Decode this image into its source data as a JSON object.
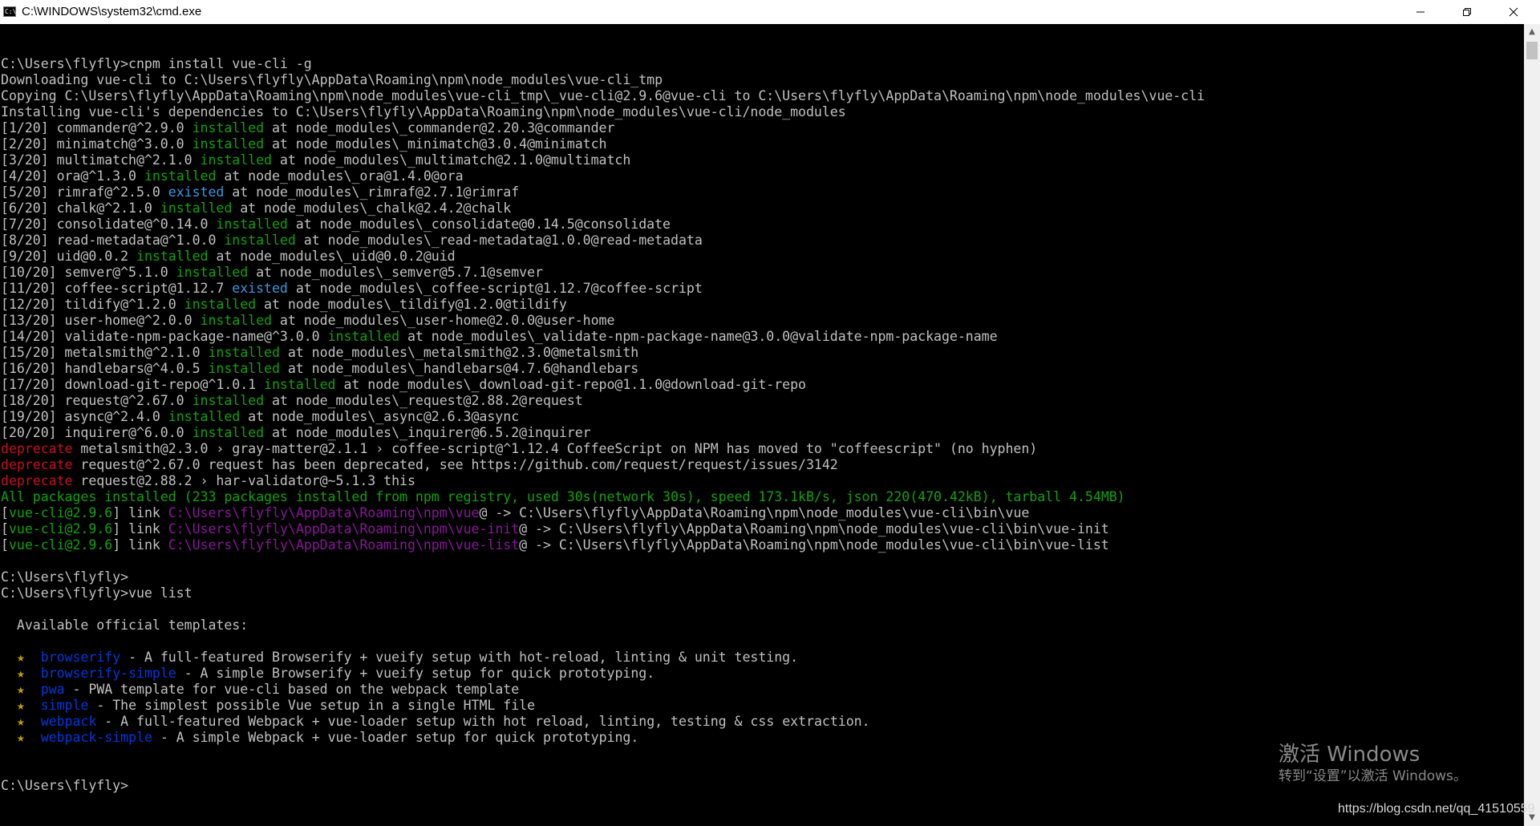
{
  "window": {
    "title": "C:\\WINDOWS\\system32\\cmd.exe",
    "app_icon_text": "C:\\",
    "icons": {
      "app": "console-icon",
      "minimize": "minimize-icon",
      "maximize": "restore-icon",
      "close": "close-icon"
    }
  },
  "console": {
    "colors": {
      "default": "#c0c0c0",
      "green": "#13a10e",
      "teal": "#3a96dd",
      "red": "#c50f1f",
      "magenta": "#881798",
      "blue": "#0037da",
      "yellow": "#c19c00"
    },
    "lines": [
      [
        {
          "t": "C:\\Users\\flyfly>cnpm install vue-cli -g"
        }
      ],
      [
        {
          "t": "Downloading vue-cli to C:\\Users\\flyfly\\AppData\\Roaming\\npm\\node_modules\\vue-cli_tmp"
        }
      ],
      [
        {
          "t": "Copying C:\\Users\\flyfly\\AppData\\Roaming\\npm\\node_modules\\vue-cli_tmp\\_vue-cli@2.9.6@vue-cli to C:\\Users\\flyfly\\AppData\\Roaming\\npm\\node_modules\\vue-cli"
        }
      ],
      [
        {
          "t": "Installing vue-cli's dependencies to C:\\Users\\flyfly\\AppData\\Roaming\\npm\\node_modules\\vue-cli/node_modules"
        }
      ],
      [
        {
          "t": "[1/20] commander@^2.9.0 "
        },
        {
          "t": "installed",
          "c": "g"
        },
        {
          "t": " at node_modules\\_commander@2.20.3@commander"
        }
      ],
      [
        {
          "t": "[2/20] minimatch@^3.0.0 "
        },
        {
          "t": "installed",
          "c": "g"
        },
        {
          "t": " at node_modules\\_minimatch@3.0.4@minimatch"
        }
      ],
      [
        {
          "t": "[3/20] multimatch@^2.1.0 "
        },
        {
          "t": "installed",
          "c": "g"
        },
        {
          "t": " at node_modules\\_multimatch@2.1.0@multimatch"
        }
      ],
      [
        {
          "t": "[4/20] ora@^1.3.0 "
        },
        {
          "t": "installed",
          "c": "g"
        },
        {
          "t": " at node_modules\\_ora@1.4.0@ora"
        }
      ],
      [
        {
          "t": "[5/20] rimraf@^2.5.0 "
        },
        {
          "t": "existed",
          "c": "t"
        },
        {
          "t": " at node_modules\\_rimraf@2.7.1@rimraf"
        }
      ],
      [
        {
          "t": "[6/20] chalk@^2.1.0 "
        },
        {
          "t": "installed",
          "c": "g"
        },
        {
          "t": " at node_modules\\_chalk@2.4.2@chalk"
        }
      ],
      [
        {
          "t": "[7/20] consolidate@^0.14.0 "
        },
        {
          "t": "installed",
          "c": "g"
        },
        {
          "t": " at node_modules\\_consolidate@0.14.5@consolidate"
        }
      ],
      [
        {
          "t": "[8/20] read-metadata@^1.0.0 "
        },
        {
          "t": "installed",
          "c": "g"
        },
        {
          "t": " at node_modules\\_read-metadata@1.0.0@read-metadata"
        }
      ],
      [
        {
          "t": "[9/20] uid@0.0.2 "
        },
        {
          "t": "installed",
          "c": "g"
        },
        {
          "t": " at node_modules\\_uid@0.0.2@uid"
        }
      ],
      [
        {
          "t": "[10/20] semver@^5.1.0 "
        },
        {
          "t": "installed",
          "c": "g"
        },
        {
          "t": " at node_modules\\_semver@5.7.1@semver"
        }
      ],
      [
        {
          "t": "[11/20] coffee-script@1.12.7 "
        },
        {
          "t": "existed",
          "c": "t"
        },
        {
          "t": " at node_modules\\_coffee-script@1.12.7@coffee-script"
        }
      ],
      [
        {
          "t": "[12/20] tildify@^1.2.0 "
        },
        {
          "t": "installed",
          "c": "g"
        },
        {
          "t": " at node_modules\\_tildify@1.2.0@tildify"
        }
      ],
      [
        {
          "t": "[13/20] user-home@^2.0.0 "
        },
        {
          "t": "installed",
          "c": "g"
        },
        {
          "t": " at node_modules\\_user-home@2.0.0@user-home"
        }
      ],
      [
        {
          "t": "[14/20] validate-npm-package-name@^3.0.0 "
        },
        {
          "t": "installed",
          "c": "g"
        },
        {
          "t": " at node_modules\\_validate-npm-package-name@3.0.0@validate-npm-package-name"
        }
      ],
      [
        {
          "t": "[15/20] metalsmith@^2.1.0 "
        },
        {
          "t": "installed",
          "c": "g"
        },
        {
          "t": " at node_modules\\_metalsmith@2.3.0@metalsmith"
        }
      ],
      [
        {
          "t": "[16/20] handlebars@^4.0.5 "
        },
        {
          "t": "installed",
          "c": "g"
        },
        {
          "t": " at node_modules\\_handlebars@4.7.6@handlebars"
        }
      ],
      [
        {
          "t": "[17/20] download-git-repo@^1.0.1 "
        },
        {
          "t": "installed",
          "c": "g"
        },
        {
          "t": " at node_modules\\_download-git-repo@1.1.0@download-git-repo"
        }
      ],
      [
        {
          "t": "[18/20] request@^2.67.0 "
        },
        {
          "t": "installed",
          "c": "g"
        },
        {
          "t": " at node_modules\\_request@2.88.2@request"
        }
      ],
      [
        {
          "t": "[19/20] async@^2.4.0 "
        },
        {
          "t": "installed",
          "c": "g"
        },
        {
          "t": " at node_modules\\_async@2.6.3@async"
        }
      ],
      [
        {
          "t": "[20/20] inquirer@^6.0.0 "
        },
        {
          "t": "installed",
          "c": "g"
        },
        {
          "t": " at node_modules\\_inquirer@6.5.2@inquirer"
        }
      ],
      [
        {
          "t": "deprecate",
          "c": "r"
        },
        {
          "t": " metalsmith@2.3.0 › gray-matter@2.1.1 › coffee-script@^1.12.4 CoffeeScript on NPM has moved to \"coffeescript\" (no hyphen)"
        }
      ],
      [
        {
          "t": "deprecate",
          "c": "r"
        },
        {
          "t": " request@^2.67.0 request has been deprecated, see https://github.com/request/request/issues/3142"
        }
      ],
      [
        {
          "t": "deprecate",
          "c": "r"
        },
        {
          "t": " request@2.88.2 › har-validator@~5.1.3 this"
        }
      ],
      [
        {
          "t": "All packages installed (233 packages installed from npm registry, used 30s(network 30s), speed 173.1kB/s, json 220(470.42kB), tarball 4.54MB)",
          "c": "g"
        }
      ],
      [
        {
          "t": "["
        },
        {
          "t": "vue-cli@2.9.6",
          "c": "g"
        },
        {
          "t": "] link "
        },
        {
          "t": "C:\\Users\\flyfly\\AppData\\Roaming\\npm\\vue",
          "c": "m"
        },
        {
          "t": "@ -> C:\\Users\\flyfly\\AppData\\Roaming\\npm\\node_modules\\vue-cli\\bin\\vue"
        }
      ],
      [
        {
          "t": "["
        },
        {
          "t": "vue-cli@2.9.6",
          "c": "g"
        },
        {
          "t": "] link "
        },
        {
          "t": "C:\\Users\\flyfly\\AppData\\Roaming\\npm\\vue-init",
          "c": "m"
        },
        {
          "t": "@ -> C:\\Users\\flyfly\\AppData\\Roaming\\npm\\node_modules\\vue-cli\\bin\\vue-init"
        }
      ],
      [
        {
          "t": "["
        },
        {
          "t": "vue-cli@2.9.6",
          "c": "g"
        },
        {
          "t": "] link "
        },
        {
          "t": "C:\\Users\\flyfly\\AppData\\Roaming\\npm\\vue-list",
          "c": "m"
        },
        {
          "t": "@ -> C:\\Users\\flyfly\\AppData\\Roaming\\npm\\node_modules\\vue-cli\\bin\\vue-list"
        }
      ],
      [
        {
          "t": ""
        }
      ],
      [
        {
          "t": "C:\\Users\\flyfly>"
        }
      ],
      [
        {
          "t": "C:\\Users\\flyfly>vue list"
        }
      ],
      [
        {
          "t": ""
        }
      ],
      [
        {
          "t": "  Available official templates:"
        }
      ],
      [
        {
          "t": ""
        }
      ],
      [
        {
          "t": "  "
        },
        {
          "t": "★",
          "c": "y"
        },
        {
          "t": "  "
        },
        {
          "t": "browserify",
          "c": "b"
        },
        {
          "t": " - A full-featured Browserify + vueify setup with hot-reload, linting & unit testing."
        }
      ],
      [
        {
          "t": "  "
        },
        {
          "t": "★",
          "c": "y"
        },
        {
          "t": "  "
        },
        {
          "t": "browserify-simple",
          "c": "b"
        },
        {
          "t": " - A simple Browserify + vueify setup for quick prototyping."
        }
      ],
      [
        {
          "t": "  "
        },
        {
          "t": "★",
          "c": "y"
        },
        {
          "t": "  "
        },
        {
          "t": "pwa",
          "c": "b"
        },
        {
          "t": " - PWA template for vue-cli based on the webpack template"
        }
      ],
      [
        {
          "t": "  "
        },
        {
          "t": "★",
          "c": "y"
        },
        {
          "t": "  "
        },
        {
          "t": "simple",
          "c": "b"
        },
        {
          "t": " - The simplest possible Vue setup in a single HTML file"
        }
      ],
      [
        {
          "t": "  "
        },
        {
          "t": "★",
          "c": "y"
        },
        {
          "t": "  "
        },
        {
          "t": "webpack",
          "c": "b"
        },
        {
          "t": " - A full-featured Webpack + vue-loader setup with hot reload, linting, testing & css extraction."
        }
      ],
      [
        {
          "t": "  "
        },
        {
          "t": "★",
          "c": "y"
        },
        {
          "t": "  "
        },
        {
          "t": "webpack-simple",
          "c": "b"
        },
        {
          "t": " - A simple Webpack + vue-loader setup for quick prototyping."
        }
      ],
      [
        {
          "t": ""
        }
      ],
      [
        {
          "t": ""
        }
      ],
      [
        {
          "t": "C:\\Users\\flyfly>"
        }
      ]
    ]
  },
  "scrollbar": {
    "up": "▲",
    "down": "▼"
  },
  "watermark": {
    "title": "激活 Windows",
    "subtitle": "转到“设置”以激活 Windows。"
  },
  "credit": "https://blog.csdn.net/qq_41510559"
}
